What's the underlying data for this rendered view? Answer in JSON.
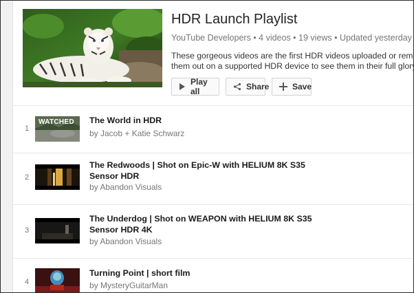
{
  "playlist": {
    "title": "HDR Launch Playlist",
    "meta": "YouTube Developers • 4 videos • 19 views • Updated yesterday",
    "description_line1": "These gorgeous videos are the first HDR videos uploaded or remastered b",
    "description_line2": "them out on a supported HDR device to see them in their full glory!",
    "hero_icon": "tiger-thumbnail"
  },
  "buttons": {
    "play_all": "Play all",
    "share": "Share",
    "save": "Save"
  },
  "videos": [
    {
      "index": "1",
      "title": "The World in HDR",
      "by": "by Jacob + Katie Schwarz",
      "watched": "WATCHED"
    },
    {
      "index": "2",
      "title": "The Redwoods | Shot on Epic-W with HELIUM 8K S35 Sensor HDR",
      "by": "by Abandon Visuals"
    },
    {
      "index": "3",
      "title": "The Underdog | Shot on WEAPON with HELIUM 8K S35 Sensor HDR 4K",
      "by": "by Abandon Visuals"
    },
    {
      "index": "4",
      "title": "Turning Point | short film",
      "by": "by MysteryGuitarMan"
    }
  ],
  "colors": {
    "text": "#222222",
    "muted": "#767676",
    "button_bg": "#fafafa",
    "border": "#d3d3d3"
  }
}
